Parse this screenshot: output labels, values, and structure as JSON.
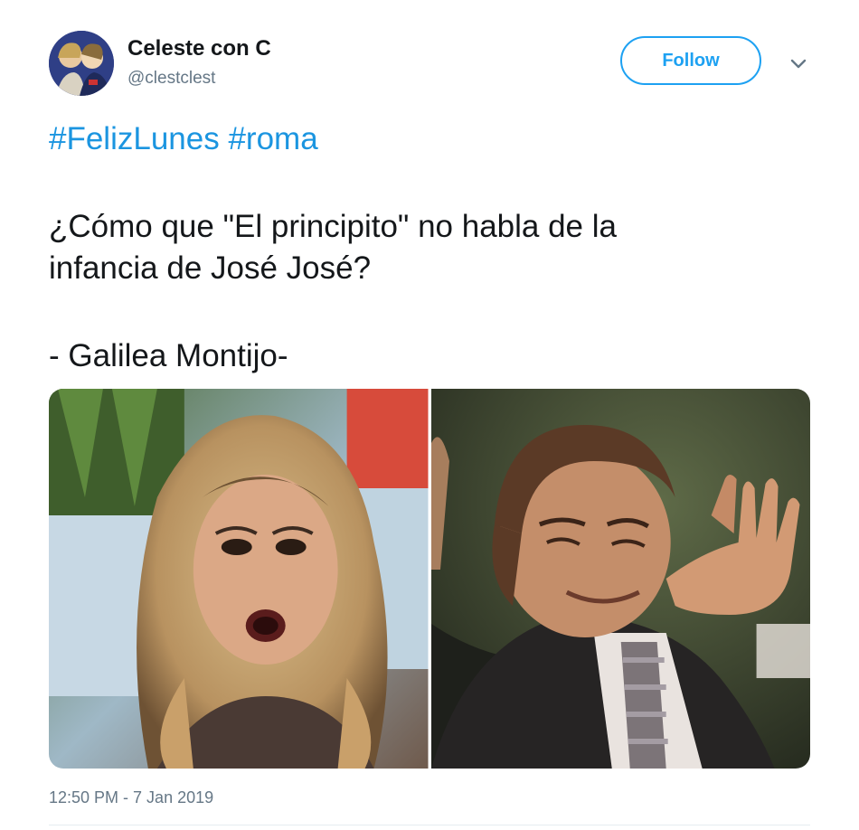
{
  "author": {
    "display_name": "Celeste con C",
    "handle": "@clestclest",
    "avatar_icon": "avatar-illustration-icon"
  },
  "follow_button": {
    "label": "Follow",
    "color": "#1da1f2"
  },
  "caret_icon": "chevron-down-icon",
  "tweet": {
    "hashtags": [
      "#FelizLunes",
      "#roma"
    ],
    "lines": [
      "¿Cómo que \"El principito\" no habla de la",
      "infancia de José José?",
      "- Galilea Montijo-"
    ],
    "hashtag_color": "#1b95e0"
  },
  "media": {
    "images": [
      {
        "name": "surprised-woman-photo"
      },
      {
        "name": "gesturing-man-photo"
      }
    ]
  },
  "timestamp": {
    "time": "12:50 PM",
    "separator": " - ",
    "date": "7 Jan 2019"
  }
}
